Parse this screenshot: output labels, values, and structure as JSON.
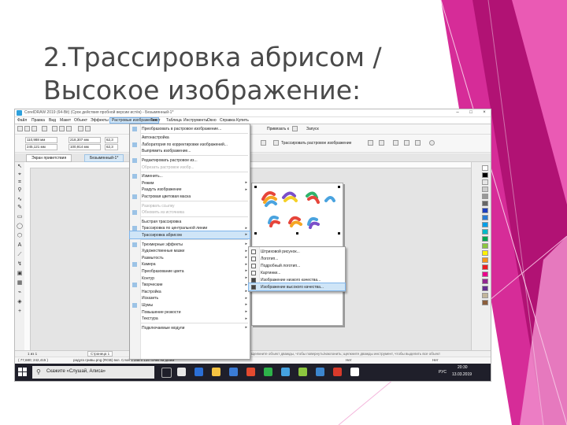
{
  "slide": {
    "title_line1": "2.Трассировка абрисом /",
    "title_line2": "Высокое изображение:"
  },
  "app": {
    "window_title": "CorelDRAW 2019 (64-Bit) (Срок действия пробной версии истёк) - Безымянный-1*",
    "menubar": [
      "Файл",
      "Правка",
      "Вид",
      "Макет",
      "Объект",
      "Эффекты",
      "Растровые изображения",
      "Текст",
      "Таблица",
      "Инструменты",
      "Окно",
      "Справка",
      "Купить"
    ],
    "active_menu_index": 6,
    "toolbar": {
      "snap_label": "Привязать к",
      "launch_label": "Запуск",
      "trace_label": "Трассировать растровое изображение"
    },
    "property_fields": {
      "x": "110,988 мм",
      "y": "245,121 мм",
      "w": "218,307 мм",
      "h": "100,914 мм",
      "sx": "62,3",
      "sy": "62,3"
    },
    "tabs": [
      "Экран приветствия",
      "Безымянный-1*"
    ],
    "statusbar": {
      "coords": "( 77,680; 242,415 )",
      "info": "радуга гривы.png (RGB) вкл. Слой 1 248 x 134 точек на дюйм",
      "fill": "Нет",
      "outline": "Нет",
      "hint": "Щелкните объект дважды, чтобы повернуть/наклонить; щелкните дважды инструмент, чтобы выделить все объекты; удерживайте нажатой клавишу Shift, чтобы выделить несколько объектов; удерживайте нажатой клавишу Alt, чтобы выбрать с обрамлением",
      "page_label": "Страница 1",
      "page_counter": "1 из 1"
    },
    "taskbar": {
      "search": "Скажите «Слушай, Алиса»",
      "lang": "РУС",
      "time": "20:30",
      "date": "13.03.2019"
    }
  },
  "main_menu": [
    {
      "label": "Преобразовать в растровое изображение...",
      "state": "normal",
      "submenu": false
    },
    {
      "sep": true
    },
    {
      "label": "Автонастройка",
      "state": "normal",
      "submenu": false
    },
    {
      "label": "Лаборатория по корректировке изображений...",
      "state": "normal",
      "submenu": false
    },
    {
      "label": "Выпрямить изображение...",
      "state": "normal",
      "submenu": false
    },
    {
      "sep": true
    },
    {
      "label": "Редактировать растровое из...",
      "state": "normal",
      "submenu": false
    },
    {
      "label": "Обрезать растровое изобр...",
      "state": "disabled",
      "submenu": false
    },
    {
      "sep": true
    },
    {
      "label": "Изменить...",
      "state": "normal",
      "submenu": false
    },
    {
      "label": "Режим",
      "state": "normal",
      "submenu": true
    },
    {
      "label": "Раздуть изображение",
      "state": "normal",
      "submenu": true
    },
    {
      "label": "Растровая цветовая маска",
      "state": "normal",
      "submenu": false
    },
    {
      "sep": true
    },
    {
      "label": "Разорвать ссылку",
      "state": "disabled",
      "submenu": false
    },
    {
      "label": "Обновить из источника",
      "state": "disabled",
      "submenu": false
    },
    {
      "sep": true
    },
    {
      "label": "Быстрая трассировка",
      "state": "normal",
      "submenu": false
    },
    {
      "label": "Трассировка по центральной линии",
      "state": "normal",
      "submenu": true
    },
    {
      "label": "Трассировка абрисом",
      "state": "highlight",
      "submenu": true
    },
    {
      "sep": true
    },
    {
      "label": "Трехмерные эффекты",
      "state": "normal",
      "submenu": true
    },
    {
      "label": "Художественные мазки",
      "state": "normal",
      "submenu": true
    },
    {
      "label": "Размытость",
      "state": "normal",
      "submenu": true
    },
    {
      "label": "Камера",
      "state": "normal",
      "submenu": true
    },
    {
      "label": "Преобразование цвета",
      "state": "normal",
      "submenu": true
    },
    {
      "label": "Контур",
      "state": "normal",
      "submenu": true
    },
    {
      "label": "Творческие",
      "state": "normal",
      "submenu": true
    },
    {
      "label": "Настройка",
      "state": "normal",
      "submenu": true
    },
    {
      "label": "Исказить",
      "state": "normal",
      "submenu": true
    },
    {
      "label": "Шумы",
      "state": "normal",
      "submenu": true
    },
    {
      "label": "Повышение резкости",
      "state": "normal",
      "submenu": true
    },
    {
      "label": "Текстура",
      "state": "normal",
      "submenu": true
    },
    {
      "sep": true
    },
    {
      "label": "Подключаемые модули",
      "state": "normal",
      "submenu": true
    }
  ],
  "sub_menu": [
    {
      "label": "Штриховой рисунок...",
      "state": "normal"
    },
    {
      "label": "Логотип...",
      "state": "normal"
    },
    {
      "label": "Подробный логотип...",
      "state": "normal"
    },
    {
      "label": "Картинки...",
      "state": "normal"
    },
    {
      "label": "Изображение низкого качества...",
      "state": "normal"
    },
    {
      "label": "Изображение высокого качества...",
      "state": "highlight"
    }
  ],
  "colors": {
    "accent_pink": "#e0198f",
    "accent_magenta": "#c0147a",
    "menu_highlight": "#cfe5f7",
    "taskbar": "#1f1f2a"
  }
}
